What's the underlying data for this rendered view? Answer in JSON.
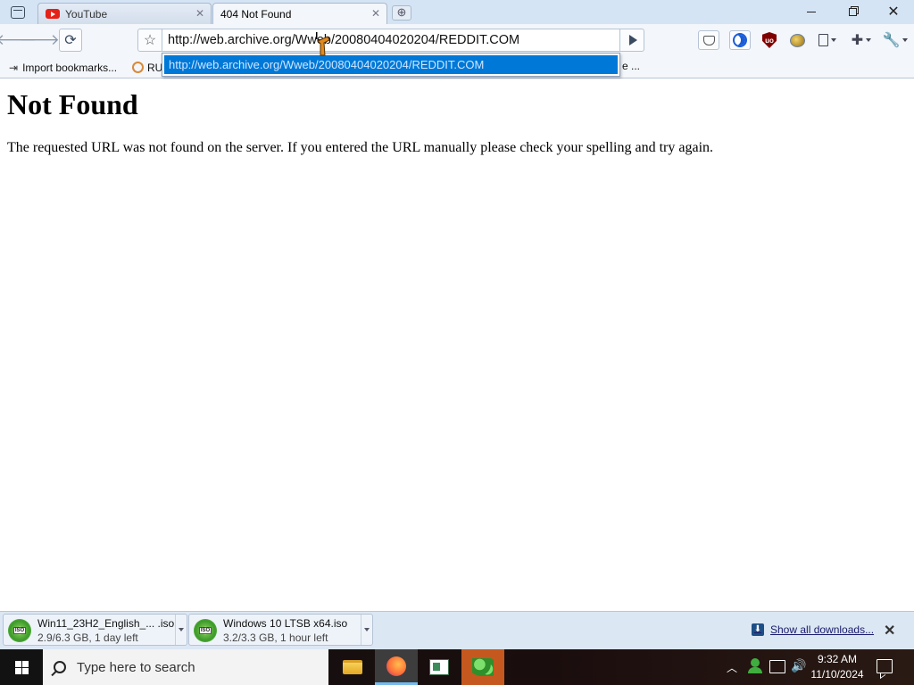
{
  "browser": {
    "tabs": [
      {
        "title": "YouTube"
      },
      {
        "title": "404 Not Found"
      }
    ],
    "address": "http://web.archive.org/Wweb/20080404020204/REDDIT.COM",
    "suggestion": "http://web.archive.org/Wweb/20080404020204/REDDIT.COM",
    "bookmarks": [
      {
        "label": "Import bookmarks..."
      },
      {
        "label": "RU"
      },
      {
        "label": "e ..."
      }
    ]
  },
  "page": {
    "title": "Not Found",
    "message": "The requested URL was not found on the server. If you entered the URL manually please check your spelling and try again."
  },
  "downloads": {
    "items": [
      {
        "name": "Win11_23H2_English_... .iso",
        "status": "2.9/6.3 GB, 1 day left"
      },
      {
        "name": "Windows 10 LTSB x64.iso",
        "status": "3.2/3.3 GB, 1 hour left"
      }
    ],
    "show_all": "Show all downloads..."
  },
  "taskbar": {
    "search_placeholder": "Type here to search",
    "time": "9:32 AM",
    "date": "11/10/2024"
  },
  "colors": {
    "suggest_highlight": "#0078d7",
    "chrome_bg": "#d5e4f5",
    "taskbar_bg": "#121212"
  }
}
